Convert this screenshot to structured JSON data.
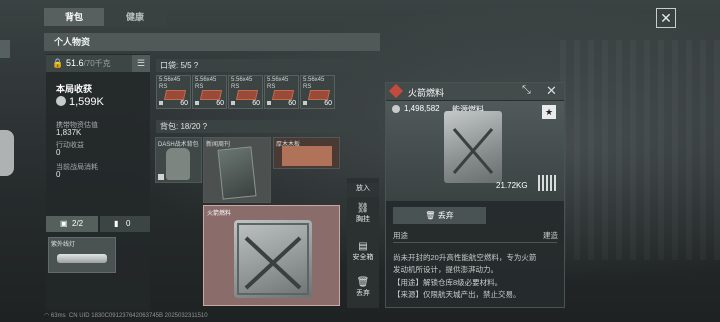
{
  "tabs": [
    {
      "label": "背包"
    },
    {
      "label": "健康"
    }
  ],
  "section_title": "个人物资",
  "weight": {
    "current": "51.6",
    "max": "/70千克"
  },
  "stats": {
    "income_title": "本局收获",
    "income_value": "1,599K",
    "carry_label": "携带物资估值",
    "carry_value": "1,837K",
    "action_label": "行动收益",
    "action_value": "0",
    "consume_label": "当前战局消耗",
    "consume_value": "0"
  },
  "pocket": {
    "label": "口袋: 5/5 ?"
  },
  "ammo_items": [
    {
      "name": "5.56x45 RS",
      "count": "60"
    },
    {
      "name": "5.56x45 RS",
      "count": "60"
    },
    {
      "name": "5.56x45 RS",
      "count": "60"
    },
    {
      "name": "5.56x45 RS",
      "count": "60"
    },
    {
      "name": "5.56x45 RS",
      "count": "60"
    }
  ],
  "bag": {
    "label": "背包: 18/20 ?"
  },
  "bag_items": [
    {
      "name": "DASH战术背包"
    },
    {
      "name": "新闻周刊"
    },
    {
      "name": "厚木木板"
    }
  ],
  "selected_item": {
    "name": "火箭燃料"
  },
  "actions": [
    {
      "label": "放入"
    },
    {
      "label": "胸挂"
    },
    {
      "label": "安全箱"
    },
    {
      "label": "丢弃"
    }
  ],
  "bottom_tabs": {
    "equip": "2/2",
    "other": "0"
  },
  "light_item": {
    "name": "紫外线灯"
  },
  "status": {
    "ping": "63ms",
    "uid": "CN UID 1830C091237642063745B 2025032311510"
  },
  "detail": {
    "title": "火箭燃料",
    "price": "1,498,582",
    "type": "能源燃料",
    "weight": "21.72KG",
    "discard_label": "丢弃",
    "use_label": "用途",
    "build_label": "建造",
    "desc_lines": [
      "尚未开封的20升高性能航空燃料，专为火箭",
      "发动机所设计，提供澎湃动力。",
      "【用途】解锁仓库8级必要材料。",
      "【来源】仅限航天城产出，禁止交易。"
    ]
  }
}
